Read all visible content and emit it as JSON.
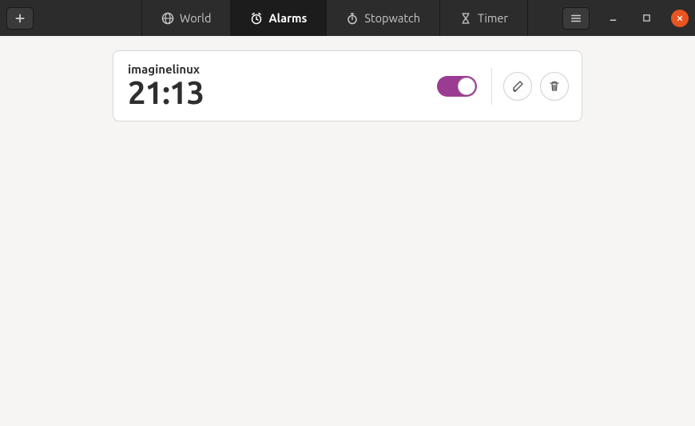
{
  "header": {
    "tabs": [
      {
        "label": "World"
      },
      {
        "label": "Alarms"
      },
      {
        "label": "Stopwatch"
      },
      {
        "label": "Timer"
      }
    ]
  },
  "alarms": [
    {
      "name": "imaginelinux",
      "time": "21:13",
      "enabled": true
    }
  ],
  "icons": {
    "add": "plus-icon",
    "menu": "hamburger-icon",
    "minimize": "minimize-icon",
    "maximize": "maximize-icon",
    "close": "close-icon",
    "world": "globe-icon",
    "alarms": "alarm-icon",
    "stopwatch": "stopwatch-icon",
    "timer": "hourglass-icon",
    "edit": "pencil-icon",
    "delete": "trash-icon"
  },
  "colors": {
    "accent": "#9a3d92",
    "close": "#e95420",
    "headerBg": "#2c2c2c",
    "activeTabBg": "#1c1c1c"
  }
}
